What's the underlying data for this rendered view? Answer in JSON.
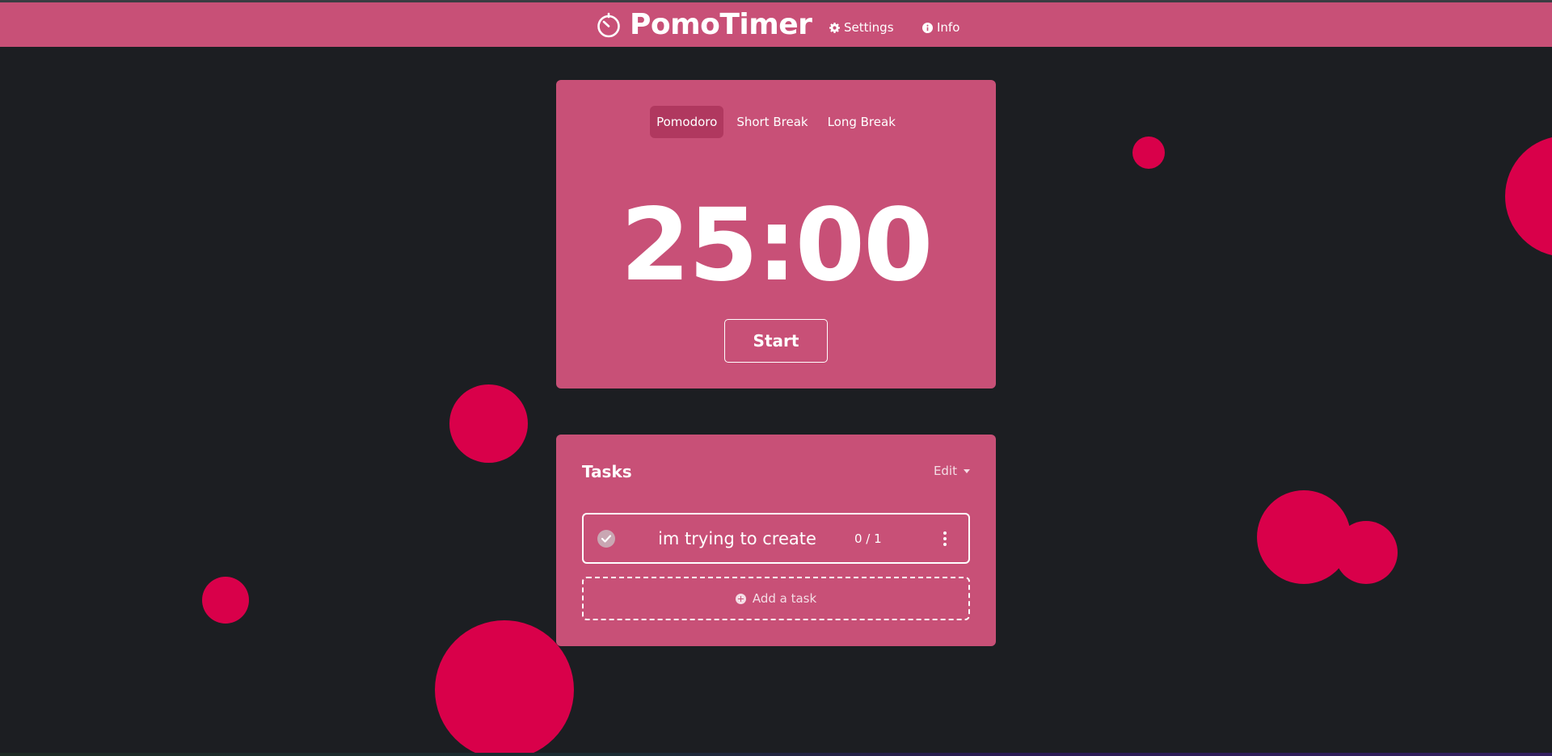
{
  "header": {
    "app_title": "PomoTimer",
    "logo_icon": "timer-icon",
    "nav": {
      "settings_label": "Settings",
      "settings_icon": "gear-icon",
      "info_label": "Info",
      "info_icon": "info-icon"
    }
  },
  "timer": {
    "tabs": [
      {
        "label": "Pomodoro",
        "active": true
      },
      {
        "label": "Short Break",
        "active": false
      },
      {
        "label": "Long Break",
        "active": false
      }
    ],
    "time": "25:00",
    "start_label": "Start"
  },
  "tasks": {
    "title": "Tasks",
    "edit_label": "Edit",
    "items": [
      {
        "text": "im trying to create",
        "count": "0 / 1",
        "done": false
      }
    ],
    "add_label": "Add a task"
  },
  "colors": {
    "background": "#1c1e22",
    "primary": "#c85077",
    "active_tab": "#b0385f",
    "circle": "#d9004a"
  }
}
